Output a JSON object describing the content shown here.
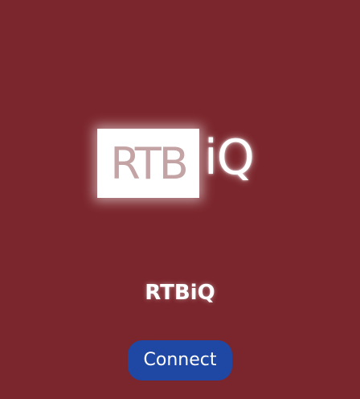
{
  "logo": {
    "boxed_text": "RTB",
    "suffix_text": "iQ"
  },
  "app": {
    "name": "RTBiQ"
  },
  "actions": {
    "connect_label": "Connect"
  },
  "colors": {
    "background": "#7b262c",
    "button": "#1f48a5",
    "logo_box": "#ffffff",
    "logo_box_text": "#c4a3a5",
    "text": "#ffffff"
  }
}
